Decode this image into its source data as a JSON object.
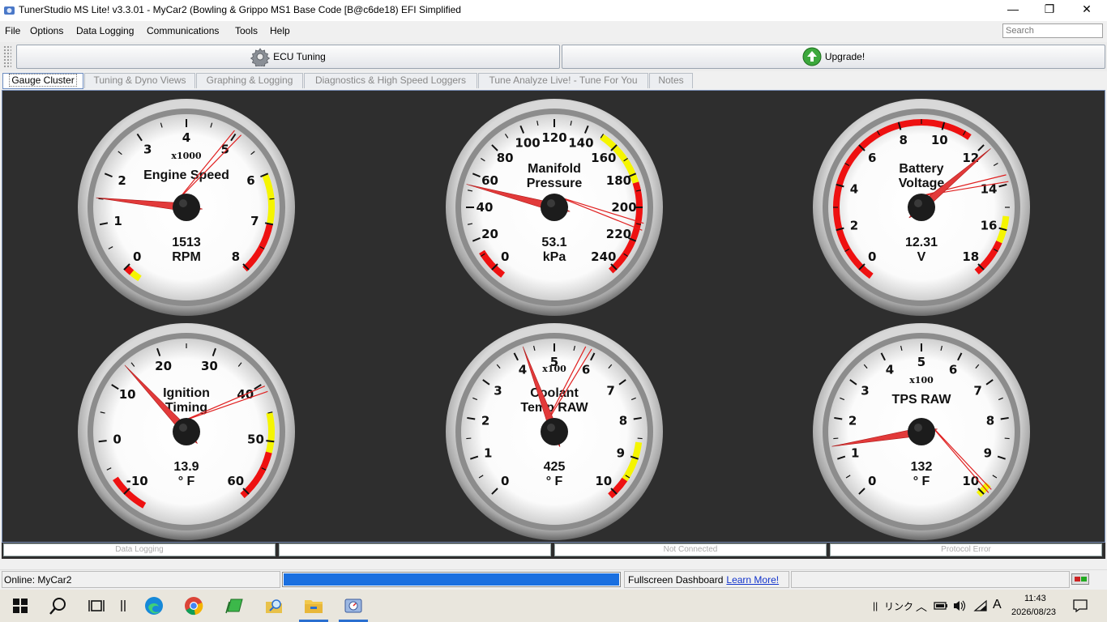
{
  "window": {
    "title": "TunerStudio MS Lite! v3.3.01 - MyCar2 (Bowling & Grippo MS1 Base Code [B@c6de18) EFI Simplified",
    "minimize_glyph": "—",
    "maximize_glyph": "❐",
    "close_glyph": "✕"
  },
  "menu": {
    "file": "File",
    "options": "Options",
    "data_logging": "Data Logging",
    "communications": "Communications",
    "tools": "Tools",
    "help": "Help"
  },
  "search": {
    "placeholder": "Search"
  },
  "toolbar": {
    "ecu_tuning": "ECU Tuning",
    "upgrade": "Upgrade!"
  },
  "tabs": [
    "Gauge Cluster",
    "Tuning & Dyno Views",
    "Graphing & Logging",
    "Diagnostics & High Speed Loggers",
    "Tune Analyze Live! - Tune For You",
    "Notes"
  ],
  "gauges": [
    {
      "key": "rpm",
      "title": [
        "Engine Speed"
      ],
      "multiplier": "x1000",
      "value": "1513",
      "units": "RPM",
      "min": 0,
      "max": 8,
      "reading": 1.513,
      "labels": [
        0,
        1,
        2,
        3,
        4,
        5,
        6,
        7,
        8
      ],
      "minor": 2,
      "bands": [
        {
          "from": -0.35,
          "to": -0.15,
          "color": "#f5f500"
        },
        {
          "from": -0.15,
          "to": 0,
          "color": "#ee1111"
        },
        {
          "from": 6,
          "to": 7,
          "color": "#f5f500"
        },
        {
          "from": 7,
          "to": 8.05,
          "color": "#ee1111"
        }
      ],
      "ghost": 5.1,
      "ghost2": 4.95
    },
    {
      "key": "map",
      "title": [
        "Manifold",
        "Pressure"
      ],
      "multiplier": "",
      "value": "53.1",
      "units": "kPa",
      "min": 0,
      "max": 240,
      "reading": 53.1,
      "labels": [
        0,
        20,
        40,
        60,
        80,
        100,
        120,
        140,
        160,
        180,
        200,
        220,
        240
      ],
      "minor": 2,
      "bands": [
        {
          "from": -7,
          "to": 12,
          "color": "#ee1111"
        },
        {
          "from": 150,
          "to": 185,
          "color": "#f5f500"
        },
        {
          "from": 185,
          "to": 243,
          "color": "#ee1111"
        }
      ],
      "ghost": 213,
      "ghost2": 209
    },
    {
      "key": "batt",
      "title": [
        "Battery",
        "Voltage"
      ],
      "multiplier": "",
      "value": "12.31",
      "units": "V",
      "min": 0,
      "max": 18,
      "reading": 12.31,
      "labels": [
        0,
        2,
        4,
        6,
        8,
        10,
        12,
        14,
        16,
        18
      ],
      "minor": 2,
      "bands": [
        {
          "from": -0.6,
          "to": 11.3,
          "color": "#ee1111"
        },
        {
          "from": 15.4,
          "to": 16.6,
          "color": "#f5f500"
        },
        {
          "from": 16.6,
          "to": 18.3,
          "color": "#ee1111"
        }
      ],
      "ghost": 13.6,
      "ghost2": 13.9
    },
    {
      "key": "ign",
      "title": [
        "Ignition",
        "Timing"
      ],
      "multiplier": "",
      "value": "13.9",
      "units": "° F",
      "min": -10,
      "max": 60,
      "reading": 13.9,
      "labels": [
        -10,
        0,
        10,
        20,
        30,
        40,
        50,
        60
      ],
      "minor": 2,
      "bands": [
        {
          "from": -14,
          "to": -7,
          "color": "#ee1111"
        },
        {
          "from": 45,
          "to": 52,
          "color": "#f5f500"
        },
        {
          "from": 52,
          "to": 61,
          "color": "#ee1111"
        }
      ],
      "ghost": 41.5,
      "ghost2": 40.5
    },
    {
      "key": "clt",
      "title": [
        "Coolant",
        "Temp RAW"
      ],
      "multiplier": "x100",
      "value": "425",
      "units": "° F",
      "min": 0,
      "max": 10,
      "reading": 4.25,
      "labels": [
        0,
        1,
        2,
        3,
        4,
        5,
        6,
        7,
        8,
        9,
        10
      ],
      "minor": 2,
      "bands": [
        {
          "from": 8.6,
          "to": 9.6,
          "color": "#f5f500"
        },
        {
          "from": 9.6,
          "to": 10.15,
          "color": "#ee1111"
        }
      ],
      "ghost": 5.9,
      "ghost2": 5.75
    },
    {
      "key": "tps",
      "title": [
        "TPS RAW"
      ],
      "multiplier": "x100",
      "value": "132",
      "units": "° F",
      "min": 0,
      "max": 10,
      "reading": 1.32,
      "labels": [
        0,
        1,
        2,
        3,
        4,
        5,
        6,
        7,
        8,
        9,
        10
      ],
      "minor": 2,
      "bands": [
        {
          "from": 9.75,
          "to": 10.1,
          "color": "#f5f500"
        }
      ],
      "ghost": 9.9,
      "ghost2": 9.8
    }
  ],
  "strip": {
    "data_logging": "Data Logging",
    "blank": "",
    "not_connected": "Not Connected",
    "protocol_error": "Protocol Error"
  },
  "status": {
    "online": "Online: MyCar2",
    "progress": 1.0,
    "fullscreen": "Fullscreen Dashboard",
    "learn_more": "Learn More!"
  },
  "taskbar": {
    "lang": "リンク",
    "ime": "A",
    "time": "11:43",
    "date": "2026/08/23"
  },
  "colors": {
    "accent": "#1a6fe0",
    "redline": "#ee1111",
    "warn": "#f5f500",
    "dash_bg": "#2e2e2e"
  }
}
